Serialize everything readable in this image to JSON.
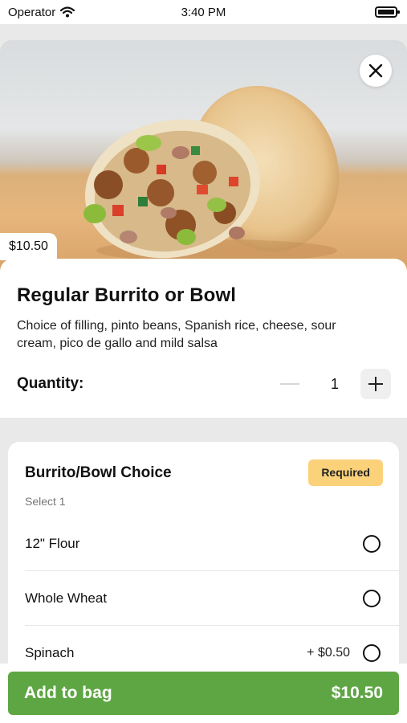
{
  "status_bar": {
    "carrier": "Operator",
    "time": "3:40 PM"
  },
  "hero": {
    "image_description_icon": "burrito-photo",
    "price": "$10.50"
  },
  "item": {
    "title": "Regular Burrito or Bowl",
    "description": "Choice of filling, pinto beans, Spanish rice, cheese, sour cream, pico de gallo and mild salsa",
    "quantity_label": "Quantity:",
    "quantity": "1"
  },
  "options": {
    "title": "Burrito/Bowl Choice",
    "badge": "Required",
    "subtitle": "Select 1",
    "items": [
      {
        "label": "12\" Flour",
        "price": ""
      },
      {
        "label": "Whole Wheat",
        "price": ""
      },
      {
        "label": "Spinach",
        "price": "+ $0.50"
      }
    ]
  },
  "cta": {
    "label": "Add to bag",
    "total": "$10.50"
  },
  "colors": {
    "accent_green": "#5ea643",
    "required_yellow": "#fbd17a"
  }
}
